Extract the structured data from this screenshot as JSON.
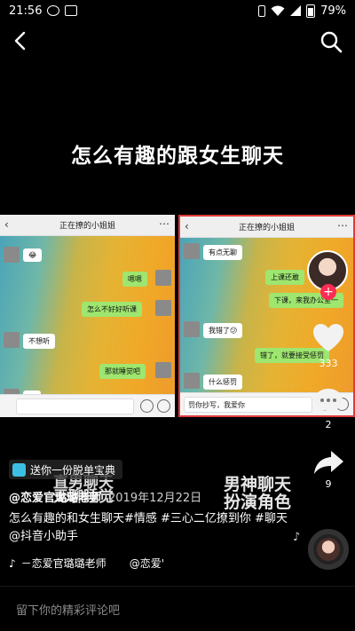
{
  "status_bar": {
    "time": "21:56",
    "battery": "79%",
    "icons": [
      "wechat-icon",
      "image-icon",
      "vibrate-icon",
      "wifi-icon",
      "cellular-icon",
      "battery-icon"
    ]
  },
  "headline": "怎么有趣的跟女生聊天",
  "left_panel": {
    "title": "正在撩的小姐姐",
    "messages": [
      "😂",
      "嗯嗯",
      "怎么不好好听课",
      "不想听",
      "那就睡觉吧",
      "嗯"
    ]
  },
  "right_panel": {
    "title": "正在撩的小姐姐",
    "messages": [
      "有点无聊",
      "上课还敢",
      "下课，来我办公室一",
      "我错了😕",
      "错了，就要接受惩罚",
      "什么惩罚",
      "罚你抄写，我爱你"
    ]
  },
  "overlay_captions": {
    "left": [
      "直男聊天",
      "无聊睡觉"
    ],
    "right": [
      "男神聊天",
      "扮演角色"
    ]
  },
  "right_rail": {
    "likes": "333",
    "comments": "2",
    "shares": "9",
    "follow_symbol": "+"
  },
  "promo": {
    "label": "送你一份脱单宝典"
  },
  "post": {
    "username": "@恋爱官璐璐老师",
    "date": "2019年12月22日",
    "description": "怎么有趣的和女生聊天#情感 #三心二亿撩到你 #聊天 @抖音小助手"
  },
  "music": {
    "text": "－恋爱官璐璐老师",
    "extra": "@恋爱'"
  },
  "comment_bar": {
    "placeholder": "留下你的精彩评论吧"
  },
  "colors": {
    "accent": "#fe2c55",
    "panel_border": "#e23b3b",
    "bubble_green": "#9ee66f"
  }
}
